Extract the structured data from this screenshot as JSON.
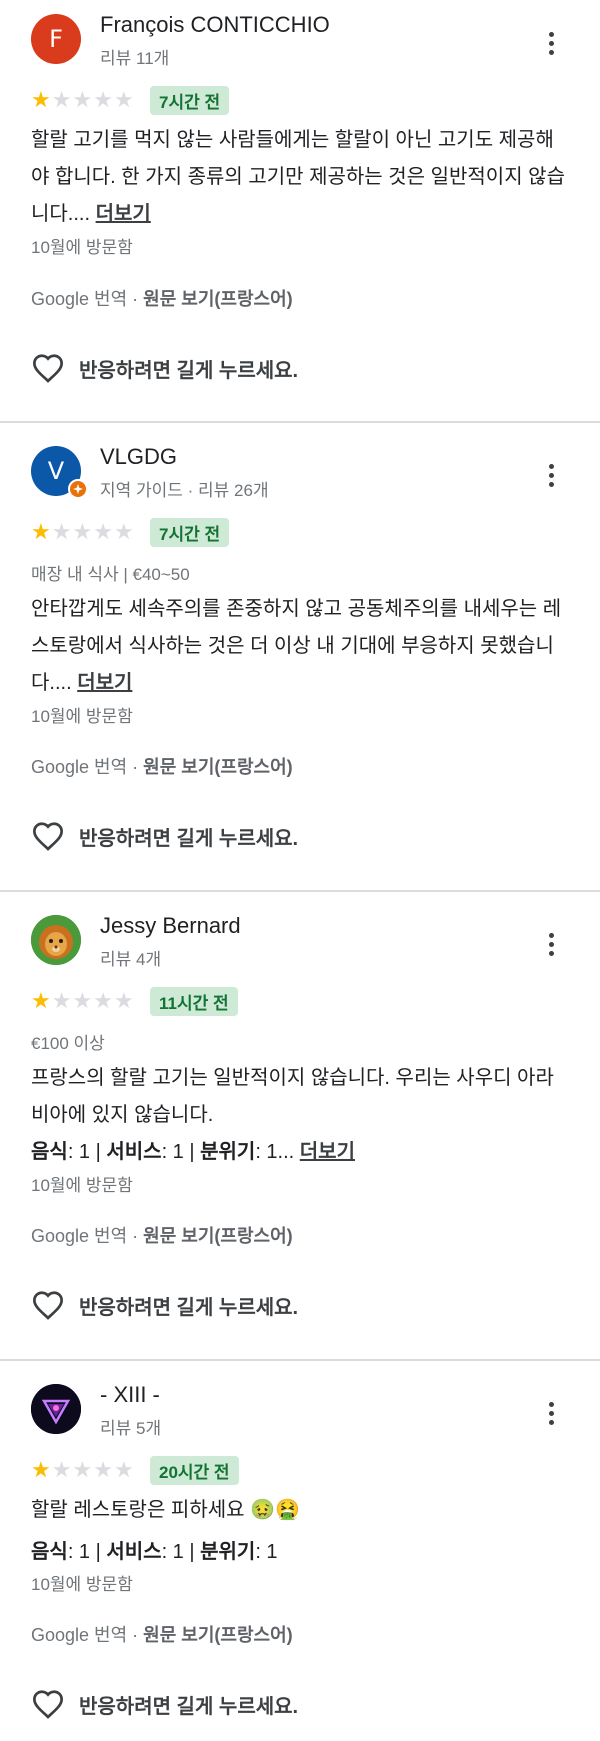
{
  "colors": {
    "star_on": "#fbbc04",
    "star_off": "#dadce0",
    "chip_bg": "#ceead6",
    "chip_text": "#137333",
    "badge": "#e8710a"
  },
  "common": {
    "more_label": "더보기",
    "translate_prefix": "Google 번역 · ",
    "translate_original": "원문 보기(프랑스어)",
    "react_label": "반응하려면 길게 누르세요.",
    "visited": "10월에 방문함"
  },
  "reviews": [
    {
      "avatar_letter": "F",
      "avatar_color": "#d93b1c",
      "name": "François CONTICCHIO",
      "meta": "리뷰 11개",
      "rating": 1,
      "time": "7시간 전",
      "text": "할랄 고기를 먹지 않는 사람들에게는 할랄이 아닌 고기도 제공해야 합니다. 한 가지 종류의 고기만 제공하는 것은 일반적이지 않습니다.... "
    },
    {
      "avatar_letter": "V",
      "avatar_color": "#0b57a8",
      "name": "VLGDG",
      "meta": "지역 가이드 · 리뷰 26개",
      "rating": 1,
      "time": "7시간 전",
      "extra": "매장 내 식사  |  €40~50",
      "text": "안타깝게도 세속주의를 존중하지 않고 공동체주의를 내세우는 레스토랑에서 식사하는 것은 더 이상 내 기대에 부응하지 못했습니다.... "
    },
    {
      "avatar_icon": "lion-cub-avatar",
      "name": "Jessy Bernard",
      "meta": "리뷰 4개",
      "rating": 1,
      "time": "11시간 전",
      "extra": "€100 이상",
      "text": "프랑스의 할랄 고기는 일반적이지 않습니다. 우리는 사우디 아라비아에 있지 않습니다.",
      "ratings_line": {
        "food_label": "음식",
        "food": ": 1 | ",
        "service_label": "서비스",
        "service": ": 1 | ",
        "mood_label": "분위기",
        "mood": ": 1... "
      }
    },
    {
      "avatar_icon": "neon-triangle-avatar",
      "name": "- XIII -",
      "meta": "리뷰 5개",
      "rating": 1,
      "time": "20시간 전",
      "text": "할랄 레스토랑은 피하세요 🤢🤮",
      "ratings_line": {
        "food_label": "음식",
        "food": ": 1 | ",
        "service_label": "서비스",
        "service": ": 1 | ",
        "mood_label": "분위기",
        "mood": ": 1"
      }
    }
  ]
}
